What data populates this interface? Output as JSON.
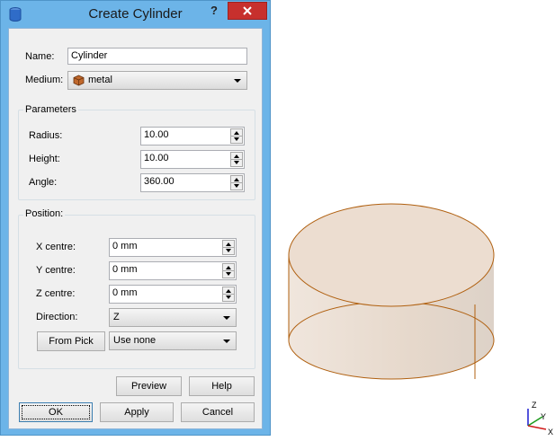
{
  "dialog": {
    "title": "Create Cylinder",
    "help_glyph": "?",
    "name_label": "Name:",
    "name_value": "Cylinder",
    "medium_label": "Medium:",
    "medium_value": "metal",
    "medium_color": "#c0682c"
  },
  "parameters": {
    "title": "Parameters",
    "rows": [
      {
        "label": "Radius:",
        "value": "10.00"
      },
      {
        "label": "Height:",
        "value": "10.00"
      },
      {
        "label": "Angle:",
        "value": "360.00"
      }
    ]
  },
  "position": {
    "title": "Position:",
    "rows": [
      {
        "label": "X centre:",
        "value": "0 mm"
      },
      {
        "label": "Y centre:",
        "value": "0 mm"
      },
      {
        "label": "Z centre:",
        "value": "0 mm"
      }
    ],
    "direction_label": "Direction:",
    "direction_value": "Z",
    "from_pick_label": "From Pick",
    "pick_value": "Use none"
  },
  "buttons": {
    "preview": "Preview",
    "help": "Help",
    "ok": "OK",
    "apply": "Apply",
    "cancel": "Cancel"
  },
  "viewport": {
    "axis_z": "Z",
    "axis_y": "Y",
    "axis_x": "X",
    "cylinder_fill": "#ecddd0",
    "cylinder_edge": "#b06010"
  }
}
